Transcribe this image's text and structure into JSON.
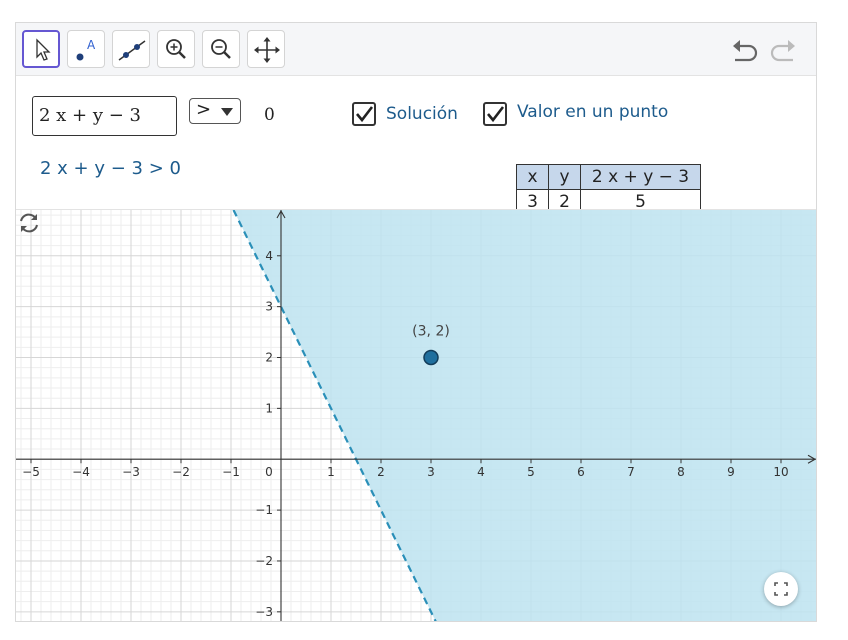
{
  "toolbar": {
    "tools": [
      {
        "name": "move-tool",
        "active": true
      },
      {
        "name": "point-tool",
        "label": "A"
      },
      {
        "name": "line-tool"
      },
      {
        "name": "zoom-in-tool"
      },
      {
        "name": "zoom-out-tool"
      },
      {
        "name": "move-graphics-view-tool"
      }
    ],
    "undo": "undo-icon",
    "redo": "redo-icon"
  },
  "algebra": {
    "expression": "2 x + y − 3",
    "operator": ">",
    "rhs": "0",
    "solucion_label": "Solución",
    "valor_label": "Valor en un punto",
    "inequality_text": "2 x + y − 3 > 0"
  },
  "value_table": {
    "headers": [
      "x",
      "y",
      "2 x + y − 3"
    ],
    "row": [
      "3",
      "2",
      "5"
    ]
  },
  "graph": {
    "point_label": "(3, 2)",
    "point": {
      "x": 3,
      "y": 2
    },
    "x_ticks": [
      "−5",
      "−4",
      "−3",
      "−2",
      "−1",
      "0",
      "1",
      "2",
      "3",
      "4",
      "5",
      "6",
      "7",
      "8",
      "9",
      "10"
    ],
    "y_ticks": [
      "4",
      "3",
      "2",
      "1",
      "−1",
      "−2",
      "−3"
    ],
    "xlim": [
      -5.3,
      10.7
    ],
    "ylim": [
      -3.2,
      4.9
    ],
    "boundary": {
      "slope": -2,
      "intercept": 3,
      "style": "dashed"
    },
    "shade_color": "#bde3f0",
    "line_color": "#2a8fb8",
    "point_color": "#1f6f9e"
  },
  "colors": {
    "accent": "#6557d2",
    "label": "#1d5b8c"
  }
}
